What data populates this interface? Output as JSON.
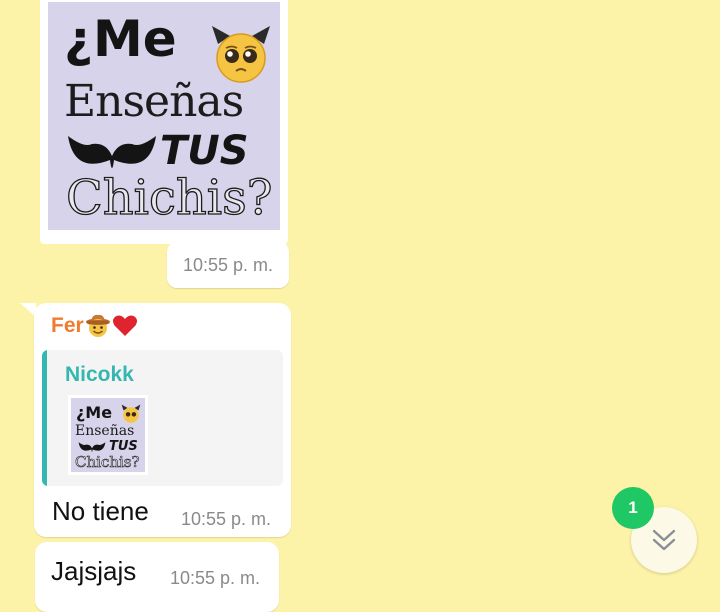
{
  "sticker": {
    "line1": "¿Me",
    "line2": "Enseñas",
    "line3": "TUS",
    "line4": "Chichis?",
    "emoji": "smiling-devil-pleading-icon",
    "graphic": "bra-silhouette-icon",
    "time": "10:55 p. m."
  },
  "reply_message": {
    "sender": "Fer",
    "sender_icons": [
      "cowboy-face-icon",
      "red-heart-icon"
    ],
    "sender_color": "#f07b2f",
    "quoted": {
      "author": "Nicokk",
      "author_color": "#35b7b0",
      "thumb_line1": "¿Me",
      "thumb_line2": "Enseñas",
      "thumb_line3": "TUS",
      "thumb_line4": "Chichis?"
    },
    "text": "No tiene",
    "time": "10:55 p. m."
  },
  "message2": {
    "text": "Jajsjajs",
    "time": "10:55 p. m."
  },
  "scroll_button": {
    "icon": "double-chevron-down-icon",
    "unread_count": "1",
    "badge_color": "#1fc864"
  },
  "colors": {
    "chat_background": "#fdf3a8",
    "bubble": "#ffffff",
    "time_text": "#8a8a8a"
  }
}
